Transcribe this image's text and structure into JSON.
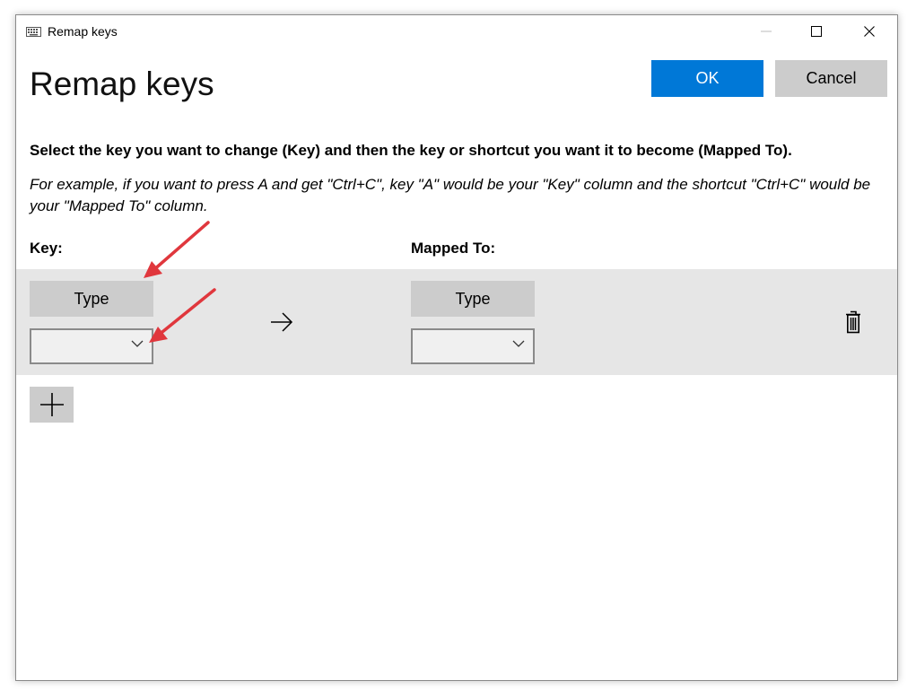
{
  "window": {
    "title": "Remap keys",
    "icon": "keyboard-icon",
    "controls": [
      "minimize-icon",
      "maximize-icon",
      "close-icon"
    ]
  },
  "header": {
    "title": "Remap keys",
    "ok_label": "OK",
    "cancel_label": "Cancel"
  },
  "instructions": {
    "main": "Select the key you want to change (Key) and then the key or shortcut you want it to become (Mapped To).",
    "example": "For example, if you want to press A and get \"Ctrl+C\", key \"A\" would be your \"Key\" column and the shortcut \"Ctrl+C\" would be your \"Mapped To\" column."
  },
  "columns": {
    "key": "Key:",
    "mapped_to": "Mapped To:"
  },
  "rows": [
    {
      "key_type_label": "Type",
      "key_value": "",
      "mapped_type_label": "Type",
      "mapped_value": "",
      "arrow_icon": "arrow-right-icon",
      "delete_icon": "trash-icon"
    }
  ],
  "add_button_icon": "plus-icon",
  "colors": {
    "accent": "#0078d7",
    "button_gray": "#cccccc",
    "row_background": "#e6e6e6",
    "annotation_arrow": "#e0373d"
  }
}
